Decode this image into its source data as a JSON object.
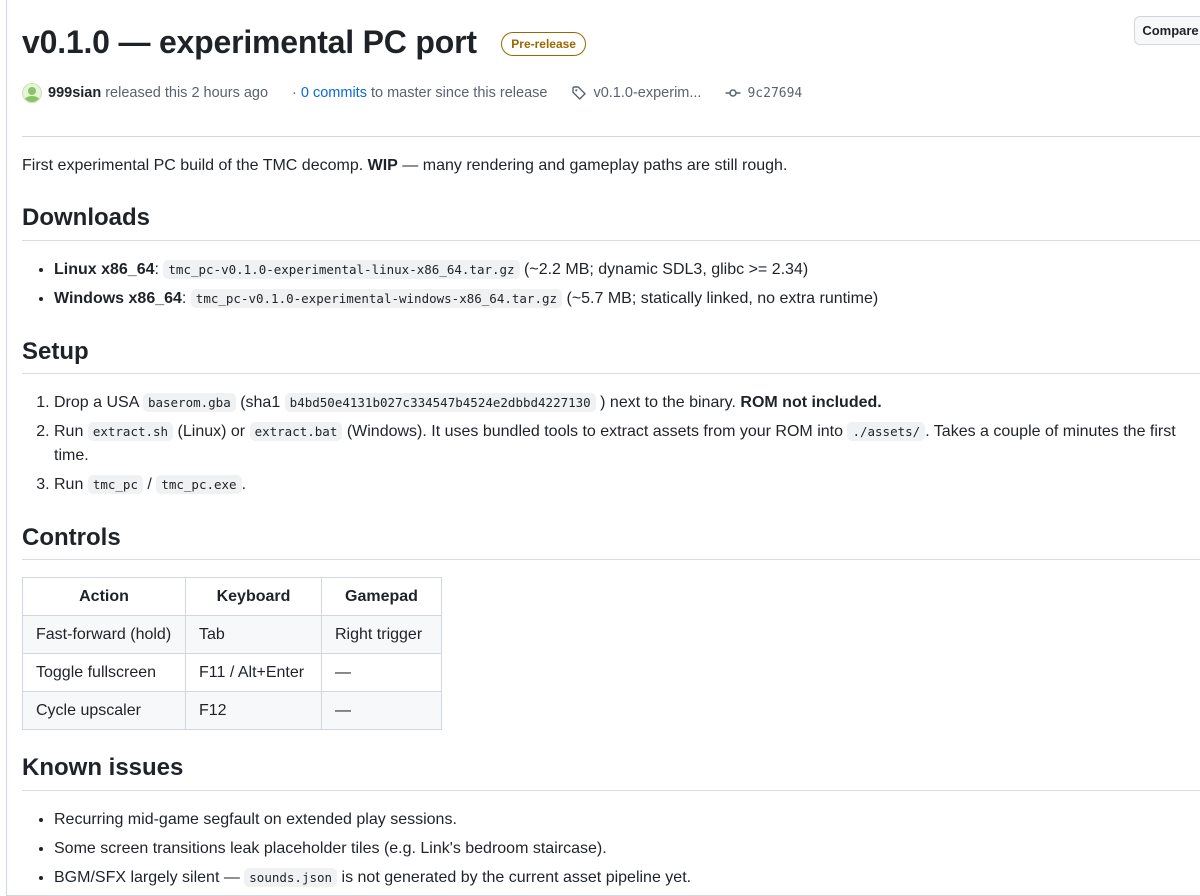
{
  "release": {
    "title": "v0.1.0 — experimental PC port",
    "badge": "Pre-release",
    "compare_label": "Compare",
    "author": "999sian",
    "released_text": "released this 2 hours ago",
    "commits_link": "0 commits",
    "commits_suffix": "to master since this release",
    "tag": "v0.1.0-experim...",
    "commit_hash": "9c27694"
  },
  "intro": {
    "prefix": "First experimental PC build of the TMC decomp.",
    "bold": "WIP",
    "suffix": "— many rendering and gameplay paths are still rough."
  },
  "downloads": {
    "heading": "Downloads",
    "items": [
      {
        "label": "Linux x86_64",
        "file": "tmc_pc-v0.1.0-experimental-linux-x86_64.tar.gz",
        "note": "(~2.2 MB; dynamic SDL3, glibc >= 2.34)"
      },
      {
        "label": "Windows x86_64",
        "file": "tmc_pc-v0.1.0-experimental-windows-x86_64.tar.gz",
        "note": "(~5.7 MB; statically linked, no extra runtime)"
      }
    ]
  },
  "setup": {
    "heading": "Setup",
    "step1": {
      "a": "Drop a USA",
      "code1": "baserom.gba",
      "b": "(sha1",
      "code2": "b4bd50e4131b027c334547b4524e2dbbd4227130",
      "c": ") next to the binary.",
      "bold": "ROM not included."
    },
    "step2": {
      "a": "Run",
      "code1": "extract.sh",
      "b": "(Linux) or",
      "code2": "extract.bat",
      "c": "(Windows). It uses bundled tools to extract assets from your ROM into",
      "code3": "./assets/",
      "d": ". Takes a couple of minutes the first time."
    },
    "step3": {
      "a": "Run",
      "code1": "tmc_pc",
      "b": "/",
      "code2": "tmc_pc.exe",
      "c": "."
    }
  },
  "controls": {
    "heading": "Controls",
    "headers": [
      "Action",
      "Keyboard",
      "Gamepad"
    ],
    "rows": [
      [
        "Fast-forward (hold)",
        "Tab",
        "Right trigger"
      ],
      [
        "Toggle fullscreen",
        "F11 / Alt+Enter",
        "—"
      ],
      [
        "Cycle upscaler",
        "F12",
        "—"
      ]
    ]
  },
  "issues": {
    "heading": "Known issues",
    "item1": "Recurring mid-game segfault on extended play sessions.",
    "item2": "Some screen transitions leak placeholder tiles (e.g. Link's bedroom staircase).",
    "item3": {
      "a": "BGM/SFX largely silent —",
      "code": "sounds.json",
      "b": "is not generated by the current asset pipeline yet."
    }
  }
}
